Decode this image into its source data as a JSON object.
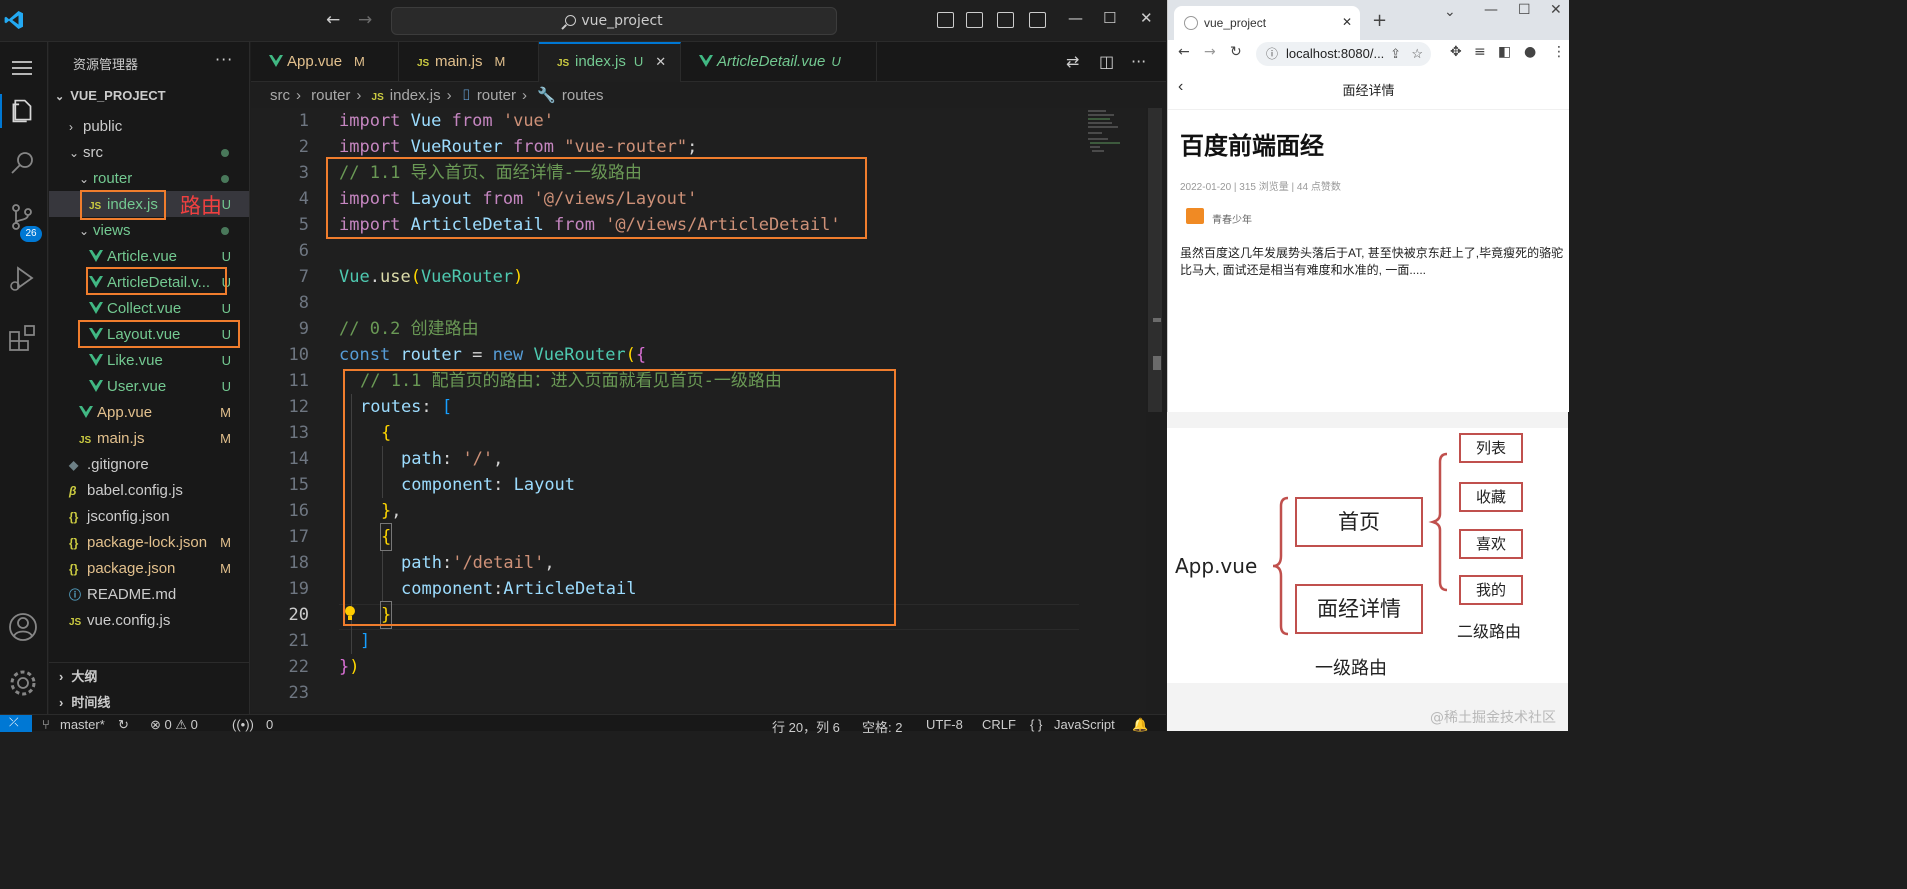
{
  "window": {
    "command_center": "vue_project"
  },
  "activity": {
    "source_control_badge": "26"
  },
  "explorer": {
    "header": "资源管理器",
    "more": "···",
    "project": "VUE_PROJECT",
    "items": [
      {
        "label": "public",
        "status": ""
      },
      {
        "label": "src",
        "status": ""
      },
      {
        "label": "router",
        "status": ""
      },
      {
        "label": "index.js",
        "status": "U"
      },
      {
        "label": "views",
        "status": ""
      },
      {
        "label": "Article.vue",
        "status": "U"
      },
      {
        "label": "ArticleDetail.v...",
        "status": "U"
      },
      {
        "label": "Collect.vue",
        "status": "U"
      },
      {
        "label": "Layout.vue",
        "status": "U"
      },
      {
        "label": "Like.vue",
        "status": "U"
      },
      {
        "label": "User.vue",
        "status": "U"
      },
      {
        "label": "App.vue",
        "status": "M"
      },
      {
        "label": "main.js",
        "status": "M"
      },
      {
        "label": ".gitignore",
        "status": ""
      },
      {
        "label": "babel.config.js",
        "status": ""
      },
      {
        "label": "jsconfig.json",
        "status": ""
      },
      {
        "label": "package-lock.json",
        "status": "M"
      },
      {
        "label": "package.json",
        "status": "M"
      },
      {
        "label": "README.md",
        "status": ""
      },
      {
        "label": "vue.config.js",
        "status": ""
      }
    ],
    "outline": "大纲",
    "timeline": "时间线"
  },
  "annotation_label": "路由",
  "tabs": [
    {
      "label": "App.vue",
      "mod": "M"
    },
    {
      "label": "main.js",
      "mod": "M"
    },
    {
      "label": "index.js",
      "mod": "U",
      "close": "✕"
    },
    {
      "label": "ArticleDetail.vue",
      "mod": "U"
    }
  ],
  "breadcrumb": [
    "src",
    "router",
    "index.js",
    "router",
    "routes"
  ],
  "code_lines": [
    {
      "n": "1"
    },
    {
      "n": "2"
    },
    {
      "n": "3"
    },
    {
      "n": "4"
    },
    {
      "n": "5"
    },
    {
      "n": "6"
    },
    {
      "n": "7"
    },
    {
      "n": "8"
    },
    {
      "n": "9"
    },
    {
      "n": "10"
    },
    {
      "n": "11"
    },
    {
      "n": "12"
    },
    {
      "n": "13"
    },
    {
      "n": "14"
    },
    {
      "n": "15"
    },
    {
      "n": "16"
    },
    {
      "n": "17"
    },
    {
      "n": "18"
    },
    {
      "n": "19"
    },
    {
      "n": "20"
    },
    {
      "n": "21"
    },
    {
      "n": "22"
    },
    {
      "n": "23"
    }
  ],
  "code": {
    "l1": [
      "import",
      " ",
      "Vue",
      " ",
      "from",
      " ",
      "'vue'"
    ],
    "l2": [
      "import",
      " ",
      "VueRouter",
      " ",
      "from",
      " ",
      "\"vue-router\"",
      ";"
    ],
    "l3": "// 1.1 导入首页、面经详情-一级路由",
    "l4": [
      "import",
      " ",
      "Layout",
      " ",
      "from",
      " ",
      "'@/views/Layout'"
    ],
    "l5": [
      "import",
      " ",
      "ArticleDetail",
      " ",
      "from",
      " ",
      "'@/views/ArticleDetail'"
    ],
    "l7": [
      "Vue",
      ".",
      "use",
      "(",
      "VueRouter",
      ")"
    ],
    "l9": "// 0.2 创建路由",
    "l10": [
      "const",
      " ",
      "router",
      " = ",
      "new",
      " ",
      "VueRouter",
      "(",
      "{"
    ],
    "l11": "// 1.1 配首页的路由：进入页面就看见首页-一级路由",
    "l12": [
      "routes",
      ": ",
      "["
    ],
    "l13": "{",
    "l14": [
      "path",
      ": ",
      "'/'",
      ","
    ],
    "l15": [
      "component",
      ": ",
      "Layout"
    ],
    "l16": [
      "}",
      ","
    ],
    "l17": "{",
    "l18": [
      "path",
      ":",
      "'/detail'",
      ","
    ],
    "l19": [
      "component",
      ":",
      "ArticleDetail"
    ],
    "l20": "}",
    "l21": "]",
    "l22": [
      "}",
      ")"
    ]
  },
  "status_bar": {
    "branch": "master*",
    "problems": "⊗ 0 ⚠ 0",
    "ports": "0",
    "position": "行 20，列 6",
    "spaces": "空格: 2",
    "encoding": "UTF-8",
    "eol": "CRLF",
    "language": "JavaScript"
  },
  "browser": {
    "tab_title": "vue_project",
    "url": "localhost:8080/...",
    "page": {
      "nav_title": "面经详情",
      "title": "百度前端面经",
      "meta": "2022-01-20 | 315 浏览量 | 44 点赞数",
      "author": "青春少年",
      "content": "虽然百度这几年发展势头落后于AT, 甚至快被京东赶上了,毕竟瘦死的骆驼比马大, 面试还是相当有难度和水准的, 一面....."
    }
  },
  "diagram": {
    "root": "App.vue",
    "level1": [
      "首页",
      "面经详情"
    ],
    "level2": [
      "列表",
      "收藏",
      "喜欢",
      "我的"
    ],
    "level1_caption": "一级路由",
    "level2_caption": "二级路由"
  },
  "watermark": "@稀土掘金技术社区",
  "colors": {
    "accent": "#0078d4",
    "annotation": "#f07d2d",
    "diagram_box": "#c0504d"
  }
}
